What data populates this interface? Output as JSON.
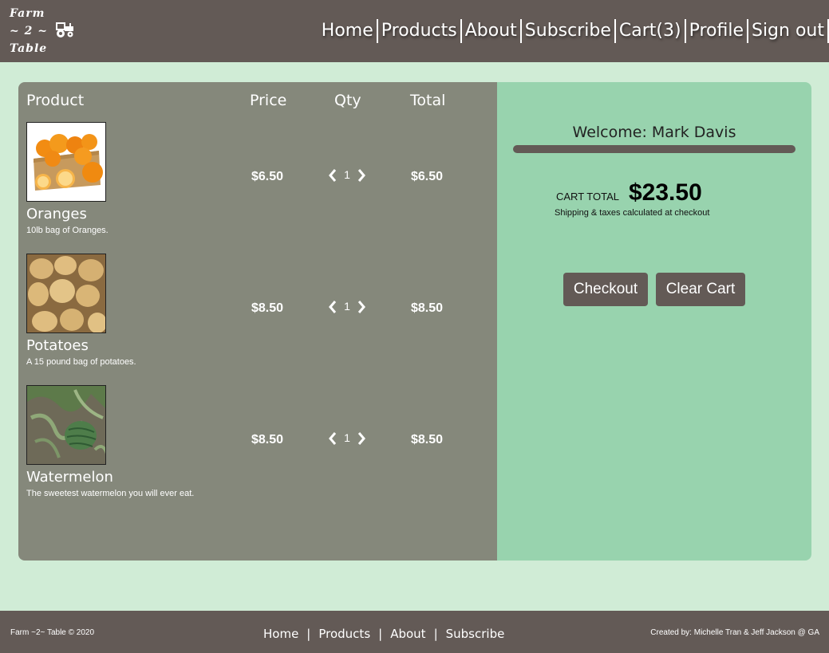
{
  "brand": {
    "line1": "Farm",
    "line2": "~ 2 ~",
    "line3": "Table",
    "icon": "tractor-icon"
  },
  "nav": {
    "items": [
      "Home",
      "Products",
      "About",
      "Subscribe",
      "Cart(3)",
      "Profile",
      "Sign out"
    ]
  },
  "cart": {
    "headers": {
      "product": "Product",
      "price": "Price",
      "qty": "Qty",
      "total": "Total"
    },
    "items": [
      {
        "name": "Oranges",
        "description": "10lb bag of Oranges.",
        "price": "$6.50",
        "qty": "1",
        "total": "$6.50",
        "image": "oranges-image"
      },
      {
        "name": "Potatoes",
        "description": "A 15 pound bag of potatoes.",
        "price": "$8.50",
        "qty": "1",
        "total": "$8.50",
        "image": "potatoes-image"
      },
      {
        "name": "Watermelon",
        "description": "The sweetest watermelon you will ever eat.",
        "price": "$8.50",
        "qty": "1",
        "total": "$8.50",
        "image": "watermelon-image"
      }
    ]
  },
  "summary": {
    "welcome": "Welcome: Mark Davis",
    "total_label": "CART TOTAL",
    "total_amount": "$23.50",
    "shipping_note": "Shipping & taxes calculated at checkout",
    "checkout_label": "Checkout",
    "clear_label": "Clear Cart"
  },
  "footer": {
    "copyright": "Farm ~2~ Table © 2020",
    "nav": [
      "Home",
      "Products",
      "About",
      "Subscribe"
    ],
    "separator": "|",
    "credit": "Created by: Michelle Tran & Jeff Jackson @ GA"
  },
  "colors": {
    "header": "#635a56",
    "page_bg": "#d0ecd6",
    "cart_pane": "#85887b",
    "summary_pane": "#98d3ae"
  }
}
